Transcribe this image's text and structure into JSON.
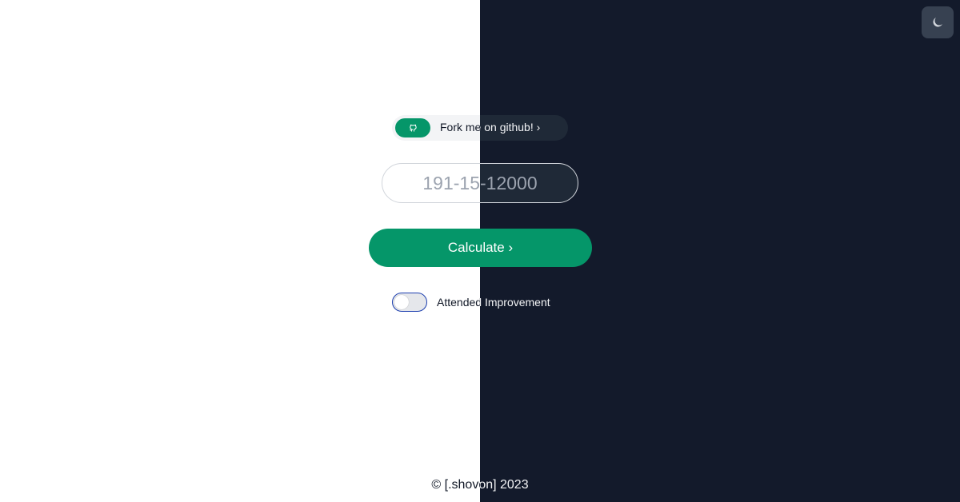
{
  "theme_toggle": {
    "icon": "moon-icon",
    "bg_color": "#374151"
  },
  "github_link": {
    "label": "Fork me on github! ›",
    "icon": "github-icon",
    "badge_color": "#059669"
  },
  "input": {
    "placeholder": "191-15-12000",
    "value": ""
  },
  "calculate_button": {
    "label": "Calculate ›",
    "color": "#059669"
  },
  "toggle": {
    "label": "Attended Improvement",
    "checked": false
  },
  "footer": {
    "text": "© [.shovon] 2023"
  },
  "colors": {
    "light_bg": "#ffffff",
    "dark_bg": "#131a2b",
    "accent": "#059669"
  }
}
